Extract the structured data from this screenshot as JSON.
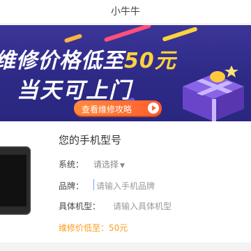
{
  "header": {
    "title": "小牛牛"
  },
  "banner": {
    "line1_prefix": "维修价格低至",
    "line1_price": "50元",
    "line2": "当天可上门",
    "cta_label": "查看维修攻略",
    "cta_icon": "play-arrow-icon",
    "colors": {
      "background": "#2d2a86",
      "price": "#ffd23c",
      "cta": "#ff6a30"
    }
  },
  "form": {
    "title": "您的手机型号",
    "system": {
      "label": "系统：",
      "value": "请选择",
      "icon": "dropdown-triangle-icon"
    },
    "brand": {
      "label": "品牌：",
      "placeholder": "请输入手机品牌"
    },
    "model": {
      "label": "具体机型：",
      "placeholder": "请输入具体机型"
    },
    "price_note": "维修价低至：50元",
    "colors": {
      "price_note": "#ff9a1a"
    }
  }
}
